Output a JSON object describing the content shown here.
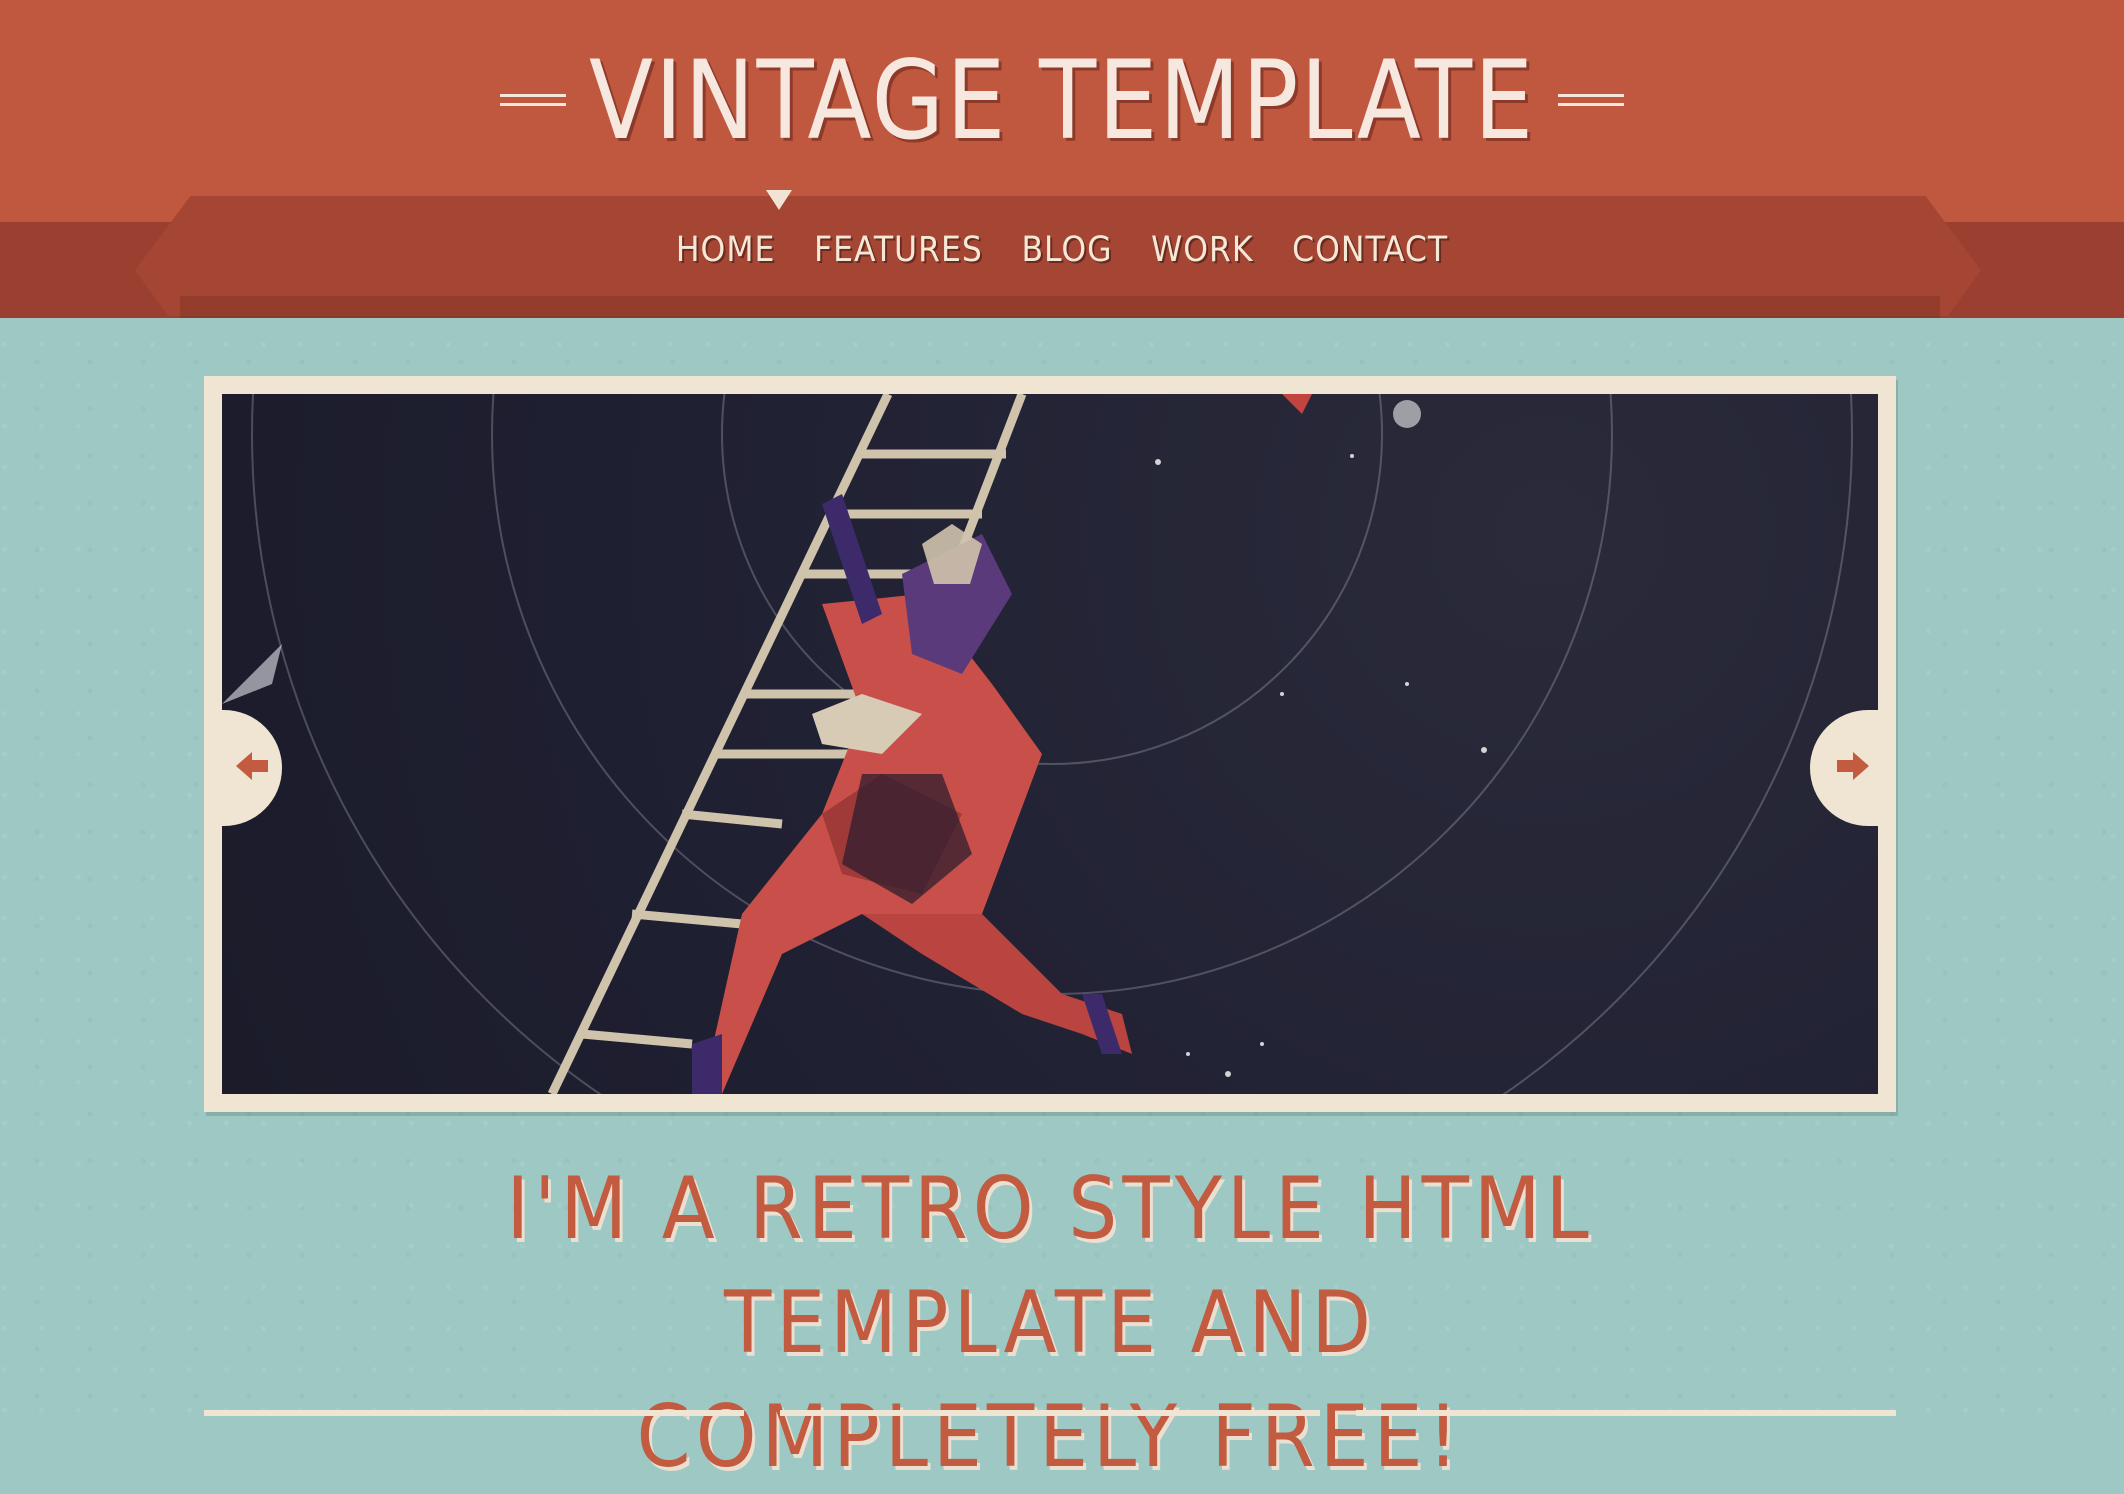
{
  "header": {
    "title": "VINTAGE TEMPLATE"
  },
  "nav": {
    "items": [
      "HOME",
      "FEATURES",
      "BLOG",
      "WORK",
      "CONTACT"
    ],
    "active": "HOME"
  },
  "slider": {
    "prev_icon": "arrow-left-icon",
    "next_icon": "arrow-right-icon"
  },
  "tagline": {
    "line1": "I'M A RETRO STYLE HTML TEMPLATE AND",
    "line2": "COMPLETELY FREE!"
  },
  "colors": {
    "header": "#c05840",
    "ribbon": "#a54533",
    "background": "#9dc8c4",
    "accent": "#c25b3f",
    "frame": "#f0e5d2",
    "slide_bg": "#1f2032"
  }
}
